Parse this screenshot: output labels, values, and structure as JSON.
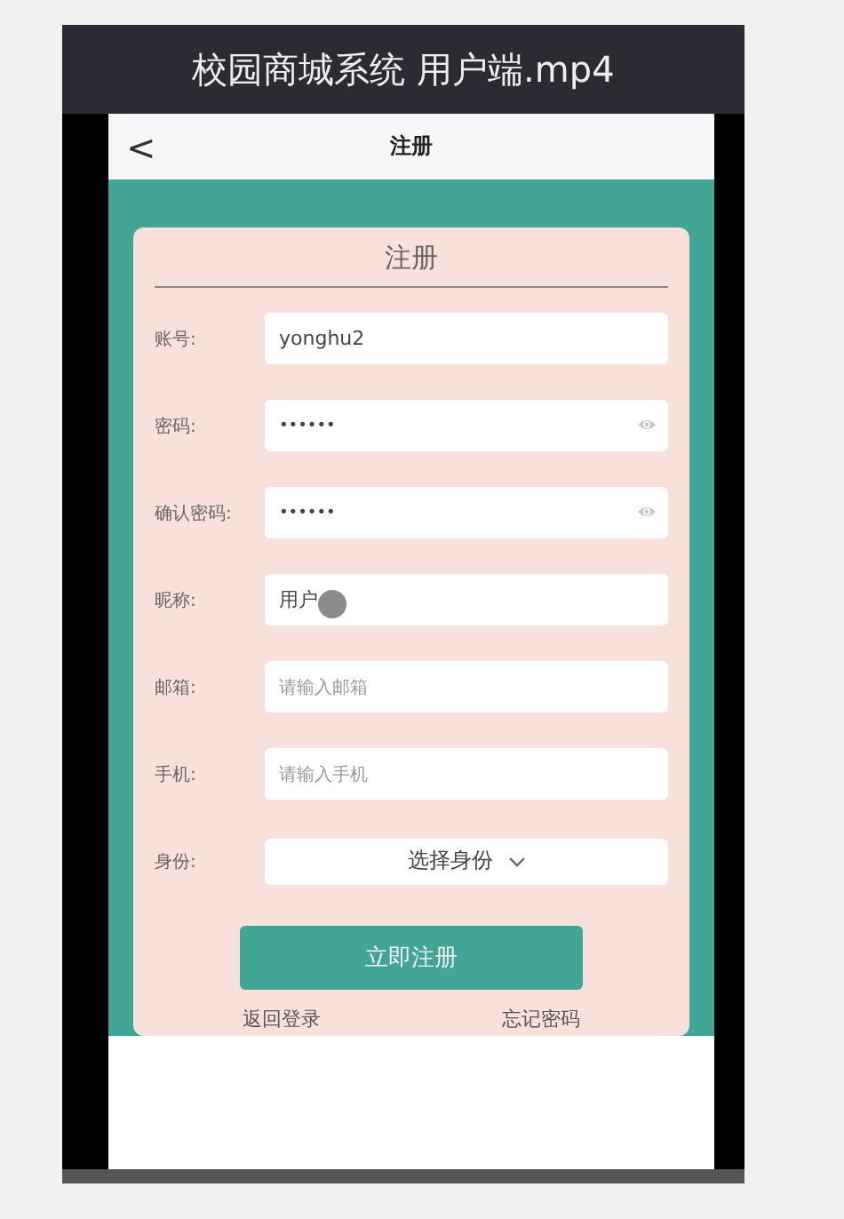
{
  "video": {
    "title": "校园商城系统 用户端.mp4"
  },
  "header": {
    "back": "<",
    "title": "注册"
  },
  "form": {
    "title": "注册",
    "fields": [
      {
        "kind": "text",
        "label": "账号:",
        "value": "yonghu2"
      },
      {
        "kind": "password",
        "label": "密码:",
        "value": "••••••"
      },
      {
        "kind": "password",
        "label": "确认密码:",
        "value": "••••••"
      },
      {
        "kind": "text",
        "label": "昵称:",
        "value": "用户"
      },
      {
        "kind": "text",
        "label": "邮箱:",
        "placeholder": "请输入邮箱"
      },
      {
        "kind": "text",
        "label": "手机:",
        "placeholder": "请输入手机"
      },
      {
        "kind": "select",
        "label": "身份:",
        "value": "选择身份"
      }
    ],
    "submit": "立即注册",
    "links": [
      "返回登录",
      "忘记密码"
    ]
  }
}
